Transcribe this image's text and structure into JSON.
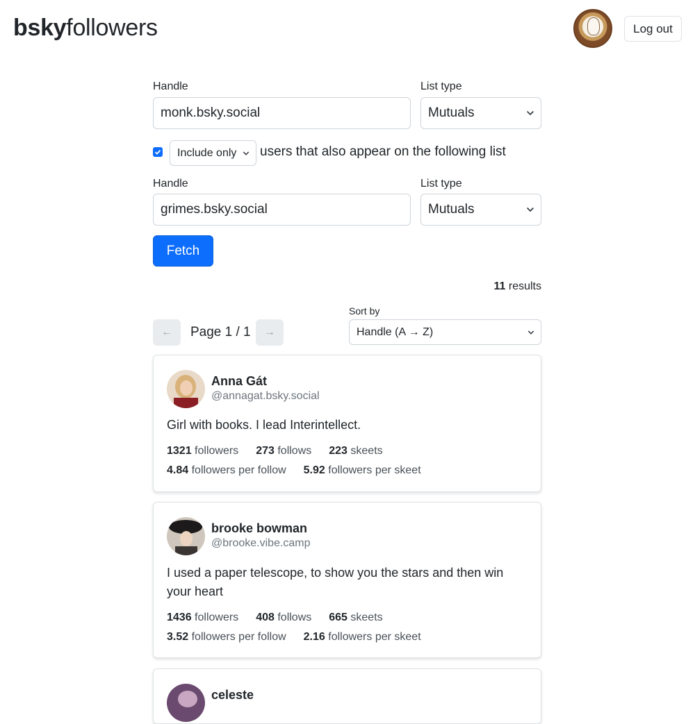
{
  "header": {
    "logo_bold": "bsky",
    "logo_light": "followers",
    "logout_label": "Log out"
  },
  "form": {
    "primary": {
      "handle_label": "Handle",
      "handle_value": "monk.bsky.social",
      "list_type_label": "List type",
      "list_type_value": "Mutuals"
    },
    "filter": {
      "checked": true,
      "mode_value": "Include only",
      "text": "users that also appear on the following list"
    },
    "secondary": {
      "handle_label": "Handle",
      "handle_value": "grimes.bsky.social",
      "list_type_label": "List type",
      "list_type_value": "Mutuals"
    },
    "fetch_label": "Fetch"
  },
  "results": {
    "count": "11",
    "count_suffix": "results",
    "page_label": "Page 1 / 1",
    "prev_icon": "←",
    "next_icon": "→",
    "sort_label": "Sort by",
    "sort_value": "Handle (A → Z)"
  },
  "users": [
    {
      "name": "Anna Gát",
      "handle": "@annagat.bsky.social",
      "bio": "Girl with books. I lead Interintellect.",
      "followers": "1321",
      "followers_label": "followers",
      "follows": "273",
      "follows_label": "follows",
      "skeets": "223",
      "skeets_label": "skeets",
      "followers_per_follow": "4.84",
      "followers_per_follow_label": "followers per follow",
      "followers_per_skeet": "5.92",
      "followers_per_skeet_label": "followers per skeet"
    },
    {
      "name": "brooke bowman",
      "handle": "@brooke.vibe.camp",
      "bio": "I used a paper telescope, to show you the stars and then win your heart",
      "followers": "1436",
      "followers_label": "followers",
      "follows": "408",
      "follows_label": "follows",
      "skeets": "665",
      "skeets_label": "skeets",
      "followers_per_follow": "3.52",
      "followers_per_follow_label": "followers per follow",
      "followers_per_skeet": "2.16",
      "followers_per_skeet_label": "followers per skeet"
    },
    {
      "name": "celeste"
    }
  ],
  "colors": {
    "primary": "#0d6efd",
    "text": "#212529",
    "muted": "#6c757d",
    "border": "#dee2e6"
  }
}
